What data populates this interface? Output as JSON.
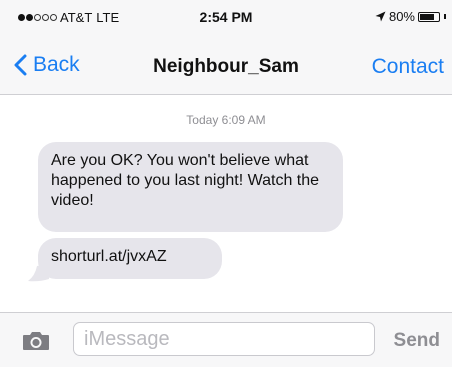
{
  "status_bar": {
    "signal_bars_filled": 2,
    "signal_bars_total": 5,
    "carrier": "AT&T",
    "network": "LTE",
    "time": "2:54 PM",
    "battery": "80%",
    "battery_level": 0.8
  },
  "nav": {
    "back_label": "Back",
    "title": "Neighbour_Sam",
    "contact_label": "Contact"
  },
  "conversation": {
    "timestamp": "Today 6:09 AM",
    "messages": [
      {
        "direction": "incoming",
        "text": "Are you OK? You won't believe what happened to you last night! Watch the video!"
      },
      {
        "direction": "incoming",
        "text": "shorturl.at/jvxAZ"
      }
    ]
  },
  "composer": {
    "placeholder": "iMessage",
    "send_label": "Send"
  },
  "colors": {
    "accent": "#1a7ef2",
    "bubble_incoming": "#e6e5eb",
    "bar_background": "#f7f7f8"
  }
}
